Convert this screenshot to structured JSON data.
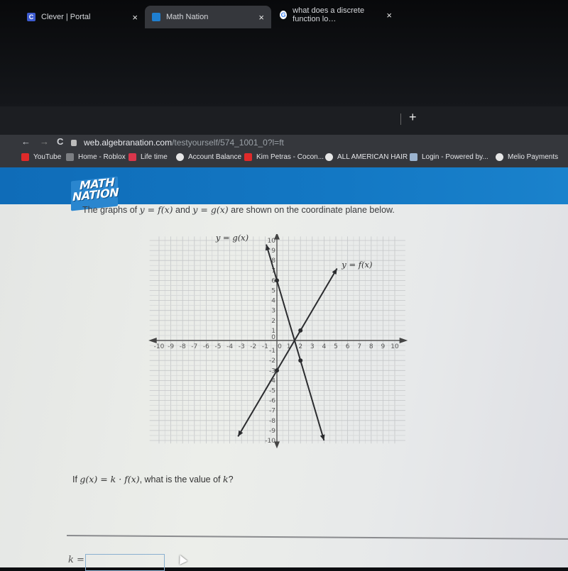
{
  "browser": {
    "tabs": [
      {
        "label": "Clever | Portal",
        "icon": "clever-icon",
        "active": false
      },
      {
        "label": "Math Nation",
        "icon": "math-nation-icon",
        "active": true
      },
      {
        "label": "what does a discrete function lo…",
        "icon": "google-icon",
        "active": false
      }
    ],
    "close_glyph": "×",
    "new_tab_glyph": "+",
    "nav": {
      "back": "←",
      "forward": "→",
      "reload": "C"
    },
    "url_host": "web.algebranation.com",
    "url_path": "/testyourself/574_1001_0?l=ft",
    "bookmarks": [
      {
        "label": "YouTube",
        "icon": "youtube-icon"
      },
      {
        "label": "Home - Roblox",
        "icon": "roblox-icon"
      },
      {
        "label": "Life time",
        "icon": "lifetime-icon"
      },
      {
        "label": "Account Balance",
        "icon": "globe-icon"
      },
      {
        "label": "Kim Petras - Cocon...",
        "icon": "youtube-icon"
      },
      {
        "label": "ALL AMERICAN HAIR",
        "icon": "globe-icon"
      },
      {
        "label": "Login - Powered by...",
        "icon": "login-icon"
      },
      {
        "label": "Melio Payments",
        "icon": "globe-icon"
      }
    ]
  },
  "page": {
    "logo": {
      "line1": "MATH",
      "line2": "NATION"
    },
    "prompt": {
      "p1": "The graphs of ",
      "m1": "y = f(x)",
      "p2": " and ",
      "m2": "y = g(x)",
      "p3": " are shown on the coordinate plane below."
    },
    "question": {
      "p1": "If ",
      "m1": "g(x) = k · f(x)",
      "p2": ", what is the value of ",
      "m2": "k",
      "p3": "?"
    },
    "answer": {
      "label": "k =",
      "value": ""
    }
  },
  "chart_data": {
    "type": "line",
    "title": "",
    "xlabel": "",
    "ylabel": "",
    "xlim": [
      -10,
      10
    ],
    "ylim": [
      -10,
      10
    ],
    "grid": true,
    "x_ticks": [
      -10,
      -9,
      -8,
      -7,
      -6,
      -5,
      -4,
      -3,
      -2,
      -1,
      0,
      1,
      2,
      3,
      4,
      5,
      6,
      7,
      8,
      9,
      10
    ],
    "y_ticks": [
      -10,
      -9,
      -8,
      -7,
      -6,
      -5,
      -4,
      -3,
      -2,
      -1,
      0,
      1,
      2,
      3,
      4,
      5,
      6,
      7,
      8,
      9,
      10
    ],
    "series": [
      {
        "name": "y = f(x)",
        "label_at": [
          5.5,
          7.3
        ],
        "segment": [
          [
            -3.3,
            -9.6
          ],
          [
            5.1,
            7.2
          ]
        ],
        "points": [
          [
            0,
            -3
          ],
          [
            2,
            1
          ]
        ]
      },
      {
        "name": "y = g(x)",
        "label_at": [
          -2.4,
          10.0
        ],
        "segment": [
          [
            -0.9,
            9.6
          ],
          [
            4.0,
            -10.0
          ]
        ],
        "points": [
          [
            0,
            6
          ],
          [
            2,
            -2
          ]
        ]
      }
    ]
  }
}
